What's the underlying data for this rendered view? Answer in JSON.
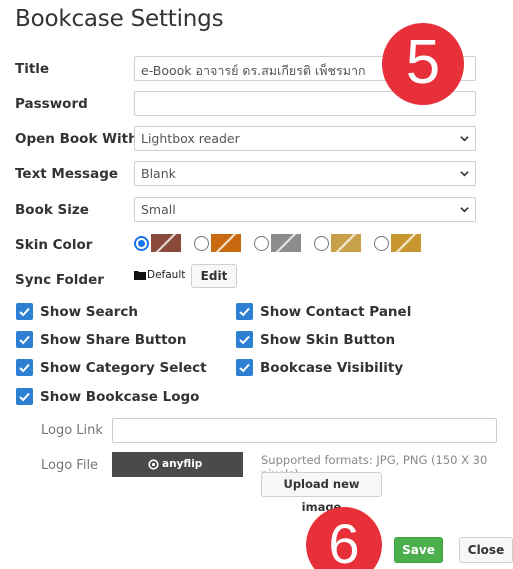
{
  "dialog": {
    "title": "Bookcase Settings"
  },
  "fields": {
    "title_label": "Title",
    "title_value": "e-Boook อาจารย์ ดร.สมเกียรติ เพ็ชรมาก",
    "password_label": "Password",
    "password_value": "",
    "open_with_label": "Open Book With",
    "open_with_value": "Lightbox reader",
    "text_message_label": "Text Message",
    "text_message_value": "Blank",
    "book_size_label": "Book Size",
    "book_size_value": "Small",
    "skin_color_label": "Skin Color",
    "sync_folder_label": "Sync Folder",
    "sync_folder_value": "Default",
    "edit_button": "Edit"
  },
  "skins": [
    {
      "selected": true,
      "color": "#8a4a3a"
    },
    {
      "selected": false,
      "color": "#c96a10"
    },
    {
      "selected": false,
      "color": "#8c8c8c"
    },
    {
      "selected": false,
      "color": "#c9a04a"
    },
    {
      "selected": false,
      "color": "#c8962e"
    }
  ],
  "checkboxes": {
    "show_search": "Show Search",
    "show_contact_panel": "Show Contact Panel",
    "show_share_button": "Show Share Button",
    "show_skin_button": "Show Skin Button",
    "show_category_select": "Show Category Select",
    "bookcase_visibility": "Bookcase Visibility",
    "show_bookcase_logo": "Show Bookcase Logo"
  },
  "logo": {
    "link_label": "Logo Link",
    "link_value": "",
    "file_label": "Logo File",
    "preview_text": "anyflip",
    "supported": "Supported formats: JPG, PNG (150 X 30 pixels)",
    "upload_button": "Upload new image"
  },
  "footer": {
    "save": "Save",
    "close": "Close"
  },
  "annotations": {
    "step5": "5",
    "step6": "6"
  },
  "colors": {
    "accent": "#2d7fd3",
    "save": "#4cae4c",
    "badge": "#e8303b"
  }
}
